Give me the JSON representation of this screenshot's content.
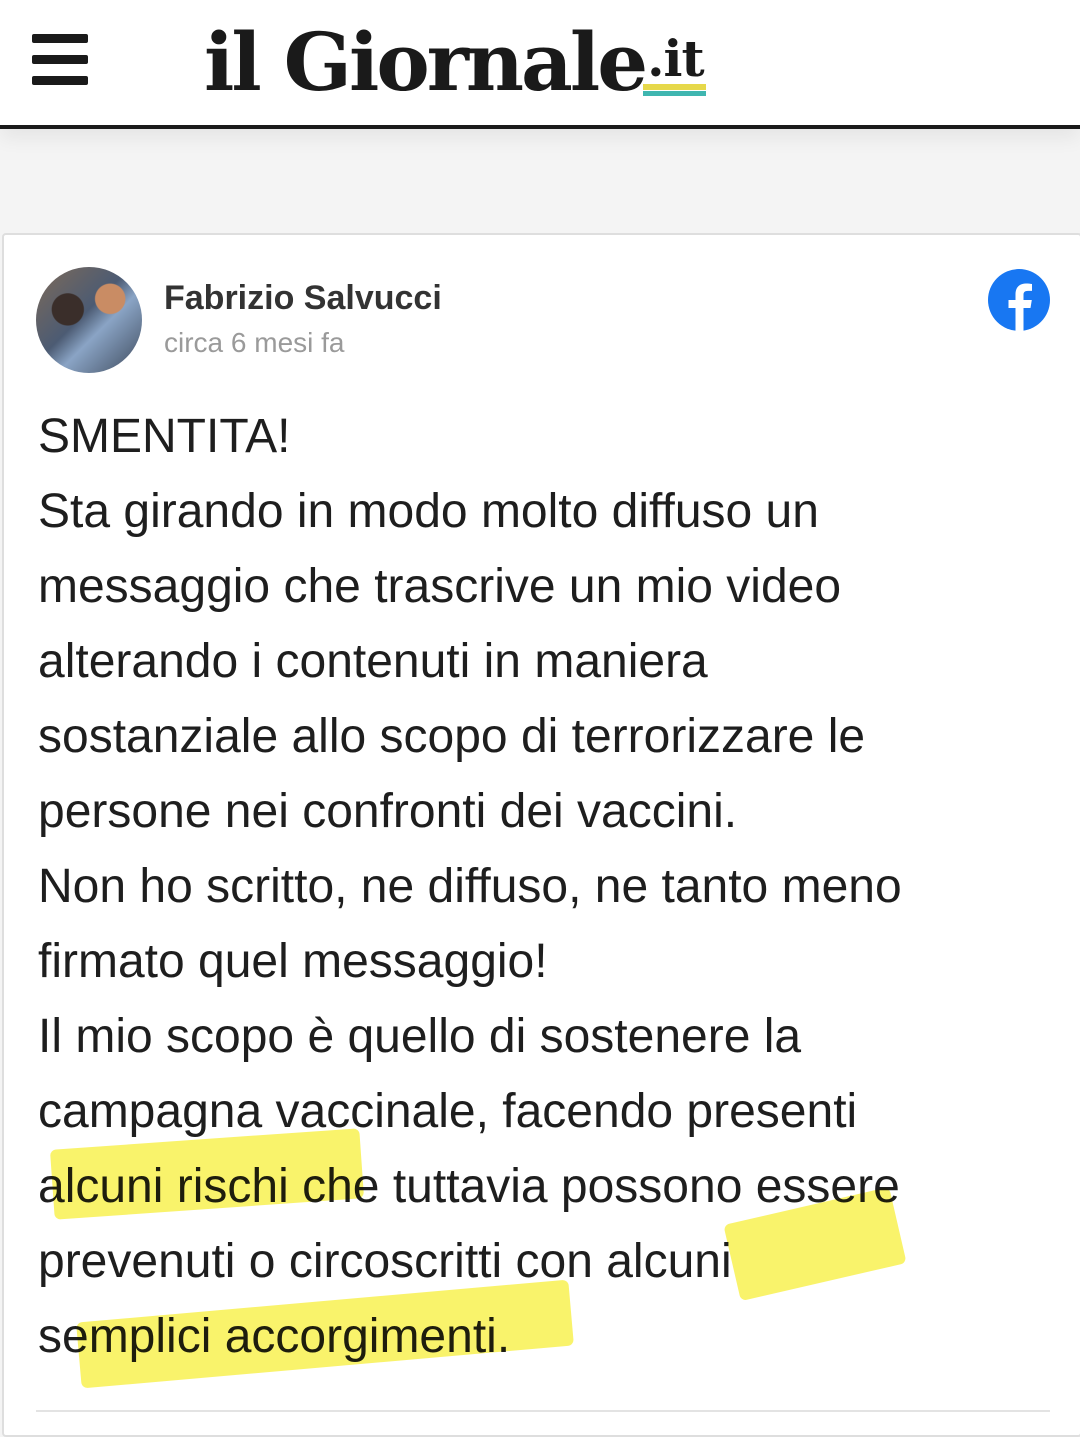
{
  "header": {
    "logo": {
      "main": "il Giornale",
      "tld": ".it"
    },
    "menu_icon": "hamburger-menu-icon"
  },
  "post": {
    "author": "Fabrizio Salvucci",
    "time": "circa 6 mesi fa",
    "source_icon": "facebook-icon",
    "body": "SMENTITA!\nSta girando in modo molto diffuso un\nmessaggio che trascrive un mio video\nalterando i contenuti in maniera\nsostanziale allo scopo di terrorizzare le\npersone nei confronti dei vaccini.\nNon ho scritto, ne diffuso, ne tanto meno\nfirmato quel messaggio!\nIl mio scopo è quello di sostenere la\ncampagna vaccinale, facendo presenti\nalcuni rischi che tuttavia possono essere\nprevenuti o circoscritti con alcuni\nsemplici accorgimenti."
  },
  "colors": {
    "highlighter": "#f6ee32",
    "facebook_blue": "#1877f2",
    "logo_underline_yellow": "#e6d84a",
    "logo_underline_teal": "#3fb6b0"
  }
}
